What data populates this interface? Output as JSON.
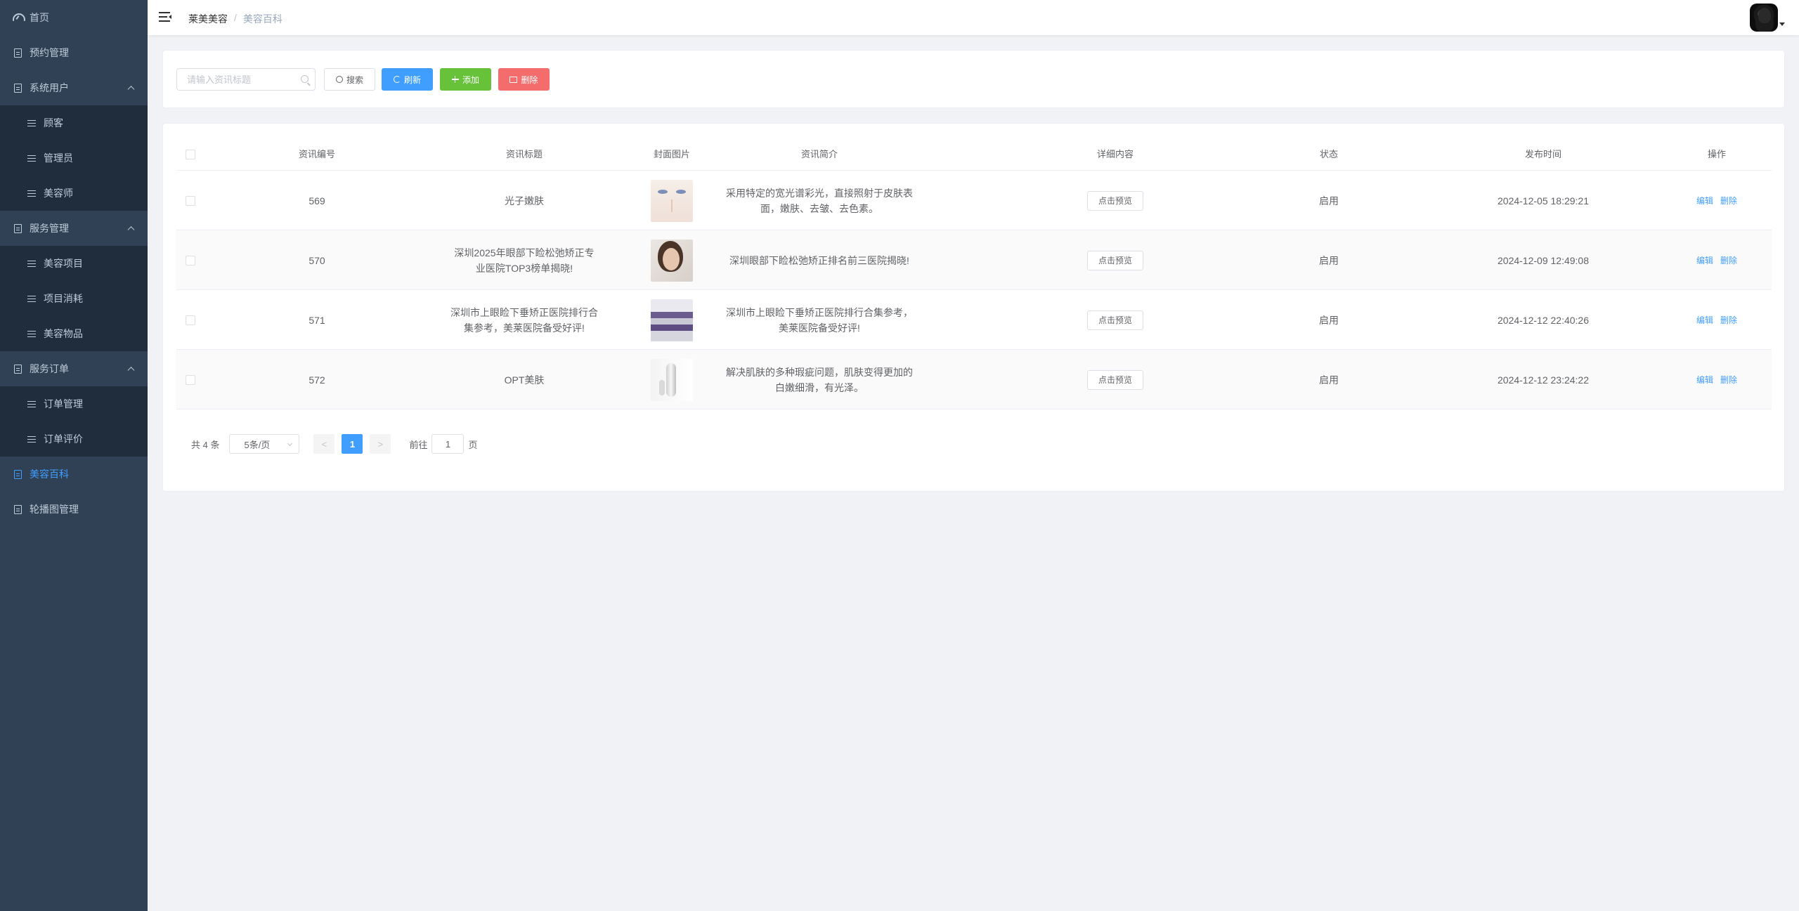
{
  "sidebar": {
    "items": [
      {
        "label": "首页"
      },
      {
        "label": "预约管理"
      },
      {
        "label": "系统用户"
      },
      {
        "label": "顾客"
      },
      {
        "label": "管理员"
      },
      {
        "label": "美容师"
      },
      {
        "label": "服务管理"
      },
      {
        "label": "美容项目"
      },
      {
        "label": "项目消耗"
      },
      {
        "label": "美容物品"
      },
      {
        "label": "服务订单"
      },
      {
        "label": "订单管理"
      },
      {
        "label": "订单评价"
      },
      {
        "label": "美容百科"
      },
      {
        "label": "轮播图管理"
      }
    ],
    "active_label": "美容百科",
    "colors": {
      "background": "#304156",
      "submenu": "#1f2d3d",
      "text": "#bfcbd9",
      "active": "#409eff"
    }
  },
  "header": {
    "breadcrumb": [
      "莱美美容",
      "/",
      "美容百科"
    ]
  },
  "toolbar": {
    "search_placeholder": "请输入资讯标题",
    "search_label": "搜索",
    "refresh_label": "刷新",
    "add_label": "添加",
    "delete_label": "删除"
  },
  "table": {
    "columns": [
      "资讯编号",
      "资讯标题",
      "封面图片",
      "资讯简介",
      "详细内容",
      "状态",
      "发布时间",
      "操作"
    ],
    "rows": [
      {
        "id": "569",
        "title": "光子嫩肤",
        "image": "face-eyes-thumbnail",
        "summary": "采用特定的宽光谱彩光，直接照射于皮肤表面，嫩肤、去皱、去色素。",
        "detail": "点击预览",
        "status": "启用",
        "time": "2024-12-05 18:29:21",
        "edit": "编辑",
        "del": "删除"
      },
      {
        "id": "570",
        "title": "深圳2025年眼部下睑松弛矫正专业医院TOP3榜单揭晓!",
        "image": "woman-portrait-thumbnail",
        "summary": "深圳眼部下睑松弛矫正排名前三医院揭晓!",
        "detail": "点击预览",
        "status": "启用",
        "time": "2024-12-09 12:49:08",
        "edit": "编辑",
        "del": "删除"
      },
      {
        "id": "571",
        "title": "深圳市上眼睑下垂矫正医院排行合集参考，美莱医院备受好评!",
        "image": "clinic-interior-thumbnail",
        "summary": "深圳市上眼睑下垂矫正医院排行合集参考，美莱医院备受好评!",
        "detail": "点击预览",
        "status": "启用",
        "time": "2024-12-12 22:40:26",
        "edit": "编辑",
        "del": "删除"
      },
      {
        "id": "572",
        "title": "OPT美肤",
        "image": "device-thumbnail",
        "summary": "解决肌肤的多种瑕疵问题，肌肤变得更加的白嫩细滑，有光泽。",
        "detail": "点击预览",
        "status": "启用",
        "time": "2024-12-12 23:24:22",
        "edit": "编辑",
        "del": "删除"
      }
    ]
  },
  "pagination": {
    "total_label": "共 4 条",
    "page_size": "5条/页",
    "prev": "<",
    "current": "1",
    "next": ">",
    "goto_prefix": "前往",
    "goto_value": "1",
    "goto_suffix": "页"
  },
  "colors": {
    "primary": "#409eff",
    "success": "#67c23a",
    "danger": "#f56c6c"
  }
}
